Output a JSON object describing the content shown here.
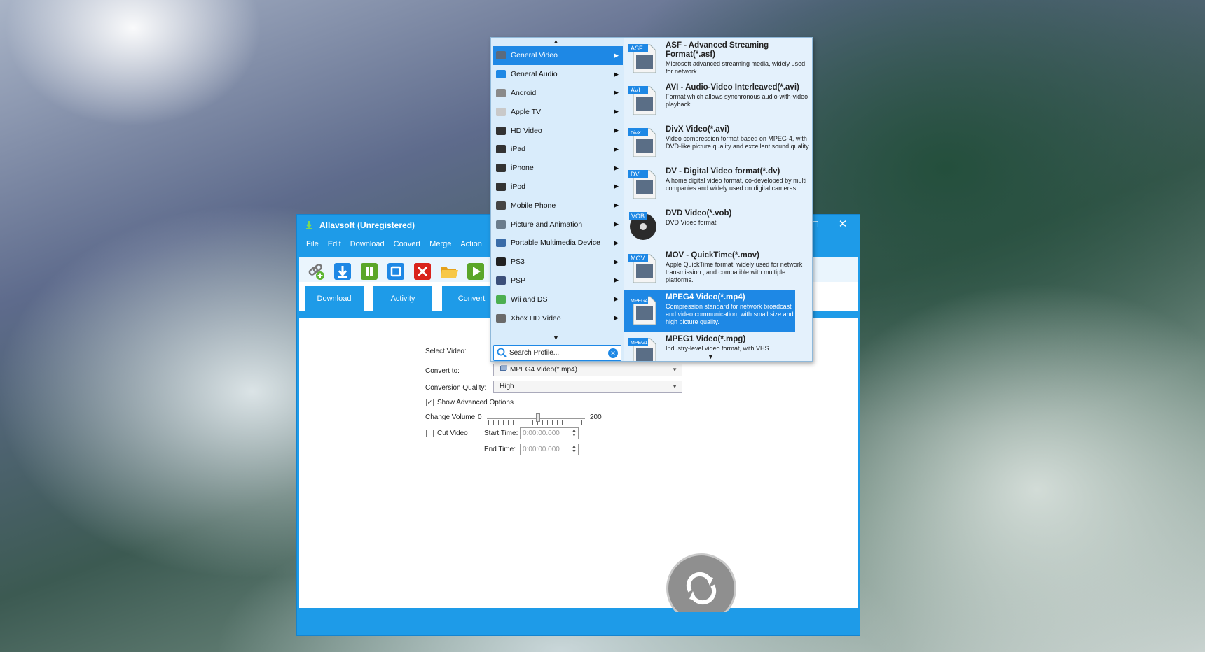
{
  "window": {
    "title": "Allavsoft (Unregistered)",
    "maximize_glyph": "□",
    "close_glyph": "✕"
  },
  "menu": [
    "File",
    "Edit",
    "Download",
    "Convert",
    "Merge",
    "Action"
  ],
  "toolbar": {
    "icons": [
      "link-add-icon",
      "download-icon",
      "pause-icon",
      "stop-icon",
      "delete-icon",
      "folder-icon",
      "play-icon"
    ]
  },
  "tabs": [
    "Download",
    "Activity",
    "Convert"
  ],
  "form": {
    "select_video_label": "Select Video:",
    "convert_to_label": "Convert to:",
    "convert_to_value": "MPEG4 Video(*.mp4)",
    "quality_label": "Conversion Quality:",
    "quality_value": "High",
    "advanced_label": "Show Advanced Options",
    "advanced_checked": true,
    "volume_label": "Change Volume:",
    "volume_min": "0",
    "volume_max": "200",
    "volume_level": 0.52,
    "cut_video_label": "Cut Video",
    "cut_video_checked": false,
    "start_time_label": "Start Time:",
    "start_time_value": "0:00:00.000",
    "end_time_label": "End Time:",
    "end_time_value": "0:00:00.000"
  },
  "popup": {
    "categories": [
      {
        "label": "General Video",
        "icon": "film-icon",
        "active": true
      },
      {
        "label": "General Audio",
        "icon": "music-note-icon"
      },
      {
        "label": "Android",
        "icon": "android-icon"
      },
      {
        "label": "Apple TV",
        "icon": "apple-tv-icon"
      },
      {
        "label": "HD Video",
        "icon": "hd-icon"
      },
      {
        "label": "iPad",
        "icon": "ipad-icon"
      },
      {
        "label": "iPhone",
        "icon": "iphone-icon"
      },
      {
        "label": "iPod",
        "icon": "ipod-icon"
      },
      {
        "label": "Mobile Phone",
        "icon": "mobile-phone-icon"
      },
      {
        "label": "Picture and Animation",
        "icon": "picture-icon"
      },
      {
        "label": "Portable Multimedia Device",
        "icon": "pmp-icon"
      },
      {
        "label": "PS3",
        "icon": "ps3-icon"
      },
      {
        "label": "PSP",
        "icon": "psp-icon"
      },
      {
        "label": "Wii and DS",
        "icon": "wii-icon"
      },
      {
        "label": "Xbox HD Video",
        "icon": "xbox-icon"
      }
    ],
    "search_placeholder": "Search Profile...",
    "formats": [
      {
        "badge": "ASF",
        "title": "ASF - Advanced Streaming Format(*.asf)",
        "desc": "Microsoft advanced streaming media, widely used for network."
      },
      {
        "badge": "AVI",
        "title": "AVI - Audio-Video Interleaved(*.avi)",
        "desc": "Format which allows synchronous audio-with-video playback."
      },
      {
        "badge": "DivX",
        "title": "DivX Video(*.avi)",
        "desc": "Video compression format based on MPEG-4, with DVD-like picture quality and excellent sound quality."
      },
      {
        "badge": "DV",
        "title": "DV - Digital Video format(*.dv)",
        "desc": "A home digital video format, co-developed by multi companies and widely used on digital cameras."
      },
      {
        "badge": "VOB",
        "title": "DVD Video(*.vob)",
        "desc": "DVD Video format"
      },
      {
        "badge": "MOV",
        "title": "MOV - QuickTime(*.mov)",
        "desc": "Apple QuickTime format, widely used for network transmission , and compatible with multiple platforms."
      },
      {
        "badge": "MPEG4",
        "title": "MPEG4 Video(*.mp4)",
        "desc": "Compression standard for network broadcast and video communication, with small size and high picture quality.",
        "active": true
      },
      {
        "badge": "MPEG1",
        "title": "MPEG1 Video(*.mpg)",
        "desc": "Industry-level video format, with VHS"
      }
    ]
  },
  "colors": {
    "accent": "#1e9be8",
    "selection": "#1e88e5",
    "popup_bg": "#d9ecfb"
  }
}
